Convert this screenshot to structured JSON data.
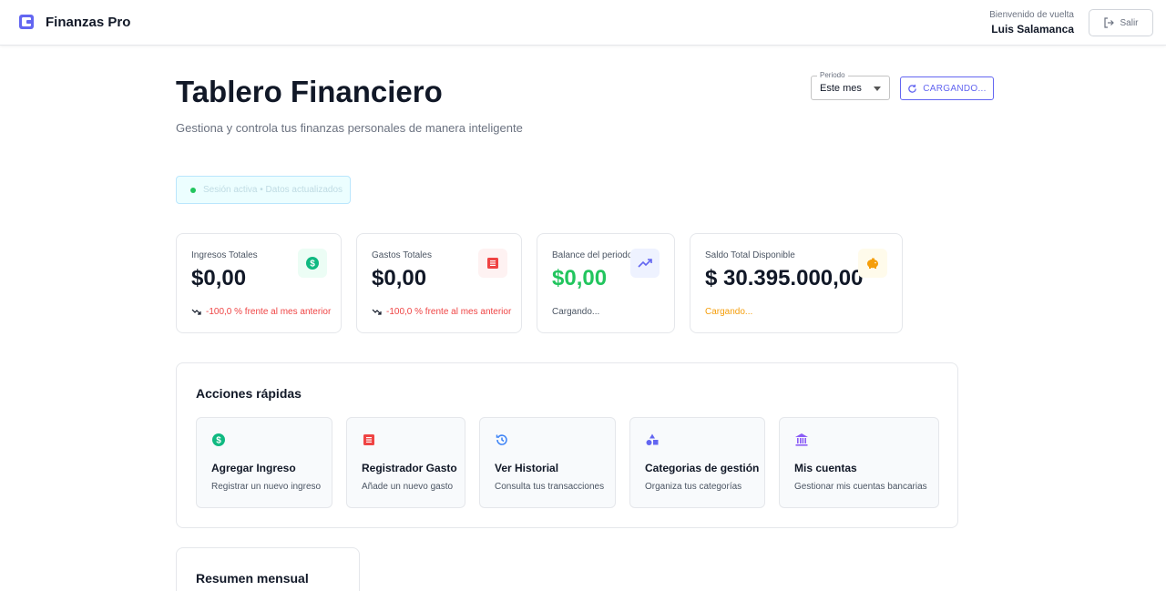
{
  "header": {
    "app_name": "Finanzas Pro",
    "welcome_label": "Bienvenido de vuelta",
    "user_name": "Luis Salamanca",
    "logout_label": "Salir"
  },
  "page": {
    "title": "Tablero Financiero",
    "subtitle": "Gestiona y controla tus finanzas personales de manera inteligente"
  },
  "controls": {
    "period_label": "Periodo",
    "period_value": "Este mes",
    "refresh_label": "CARGANDO..."
  },
  "session": {
    "status_text": "Sesión activa • Datos actualizados"
  },
  "stats": [
    {
      "label": "Ingresos Totales",
      "value": "$0,00",
      "footer": "-100,0 % frente al mes anterior",
      "icon": "dollar-icon"
    },
    {
      "label": "Gastos Totales",
      "value": "$0,00",
      "footer": "-100,0 % frente al mes anterior",
      "icon": "receipt-icon"
    },
    {
      "label": "Balance del periodo",
      "value": "$0,00",
      "footer": "Cargando...",
      "icon": "trending-up-icon"
    },
    {
      "label": "Saldo Total Disponible",
      "value": "$ 30.395.000,00",
      "footer": "Cargando...",
      "icon": "piggy-bank-icon"
    }
  ],
  "quick_actions": {
    "title": "Acciones rápidas",
    "items": [
      {
        "name": "Agregar Ingreso",
        "desc": "Registrar un nuevo ingreso",
        "icon": "dollar-icon"
      },
      {
        "name": "Registrador Gasto",
        "desc": "Añade un nuevo gasto",
        "icon": "receipt-icon"
      },
      {
        "name": "Ver Historial",
        "desc": "Consulta tus transacciones",
        "icon": "history-icon"
      },
      {
        "name": "Categorias de gestión",
        "desc": "Organiza tus categorías",
        "icon": "shapes-icon"
      },
      {
        "name": "Mis cuentas",
        "desc": "Gestionar mis cuentas bancarias",
        "icon": "bank-icon"
      }
    ]
  },
  "summary": {
    "title": "Resumen mensual"
  },
  "colors": {
    "brand": "#6366f1",
    "income_green": "#10b981",
    "expense_red": "#ef4444",
    "balance_green": "#22c55e",
    "warning_orange": "#f59e0b"
  }
}
